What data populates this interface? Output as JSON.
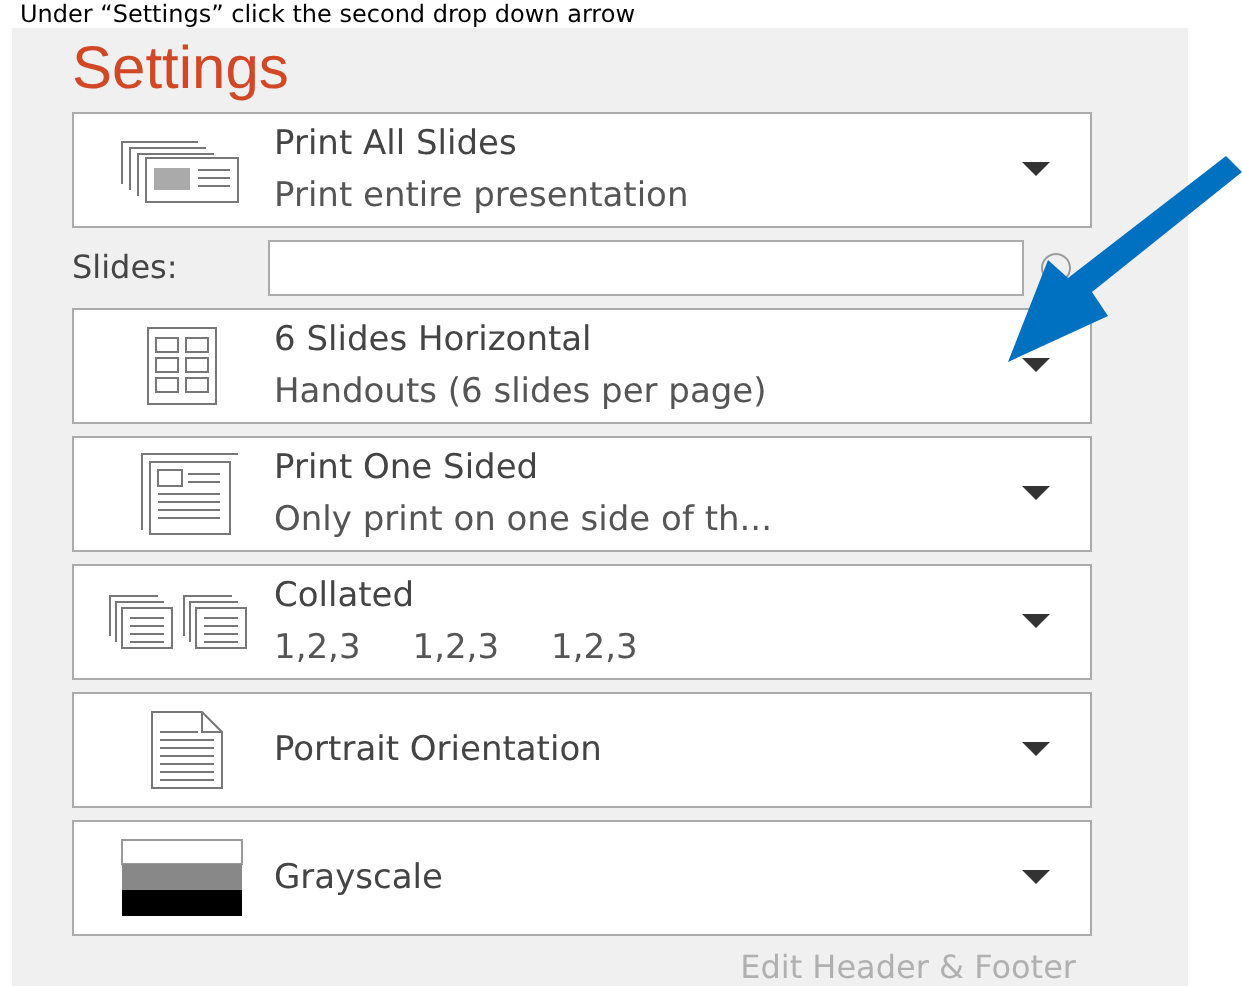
{
  "caption": "Under “Settings” click the second drop down arrow",
  "settings": {
    "title": "Settings",
    "dropdowns_top": [
      {
        "kind": "slides",
        "title": "Print All Slides",
        "subtitle": [
          "Print entire presentation"
        ]
      }
    ],
    "slides_field": {
      "label": "Slides:"
    },
    "dropdowns": [
      {
        "kind": "handouts",
        "title": "6 Slides Horizontal",
        "subtitle": [
          "Handouts (6 slides per page)"
        ]
      },
      {
        "kind": "one-sided",
        "title": "Print One Sided",
        "subtitle": [
          "Only print on one side of th..."
        ]
      },
      {
        "kind": "collated",
        "title": "Collated",
        "subtitle": [
          "1,2,3",
          "1,2,3",
          "1,2,3"
        ]
      },
      {
        "kind": "portrait",
        "title": "Portrait Orientation"
      },
      {
        "kind": "grayscale",
        "title": "Grayscale"
      }
    ],
    "footer_link": "Edit Header & Footer"
  }
}
